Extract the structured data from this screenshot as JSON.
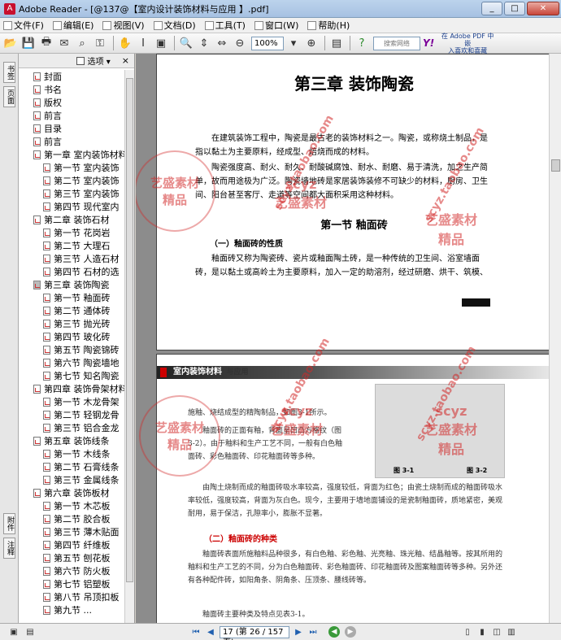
{
  "window": {
    "title": "Adobe Reader - [@137@【室内设计装饰材料与应用 】.pdf]",
    "min": "_",
    "max": "□",
    "close": "✕"
  },
  "menu": [
    {
      "label": "文件(F)"
    },
    {
      "label": "编辑(E)"
    },
    {
      "label": "视图(V)"
    },
    {
      "label": "文档(D)"
    },
    {
      "label": "工具(T)"
    },
    {
      "label": "窗口(W)"
    },
    {
      "label": "帮助(H)"
    }
  ],
  "toolbar": {
    "zoom_value": "100%",
    "search_placeholder": "搜索网络",
    "yahoo": "Y!",
    "promo_line1": "在 Adobe PDF 中嵌",
    "promo_line2": "入喜欢和喜藏"
  },
  "left_tabs": {
    "pages": "书签",
    "thumbs": "页面",
    "attach": "附件",
    "comments": "注释"
  },
  "sidebar": {
    "options_label": "选项 ▾",
    "close": "×",
    "bookmarks": [
      {
        "label": "封面",
        "level": 0
      },
      {
        "label": "书名",
        "level": 0
      },
      {
        "label": "版权",
        "level": 0
      },
      {
        "label": "前言",
        "level": 0
      },
      {
        "label": "目录",
        "level": 0
      },
      {
        "label": "前言",
        "level": 0
      },
      {
        "label": "第一章 室内装饰材料",
        "level": 0
      },
      {
        "label": "第一节 室内装饰",
        "level": 1
      },
      {
        "label": "第二节 室内装饰",
        "level": 1
      },
      {
        "label": "第三节 室内装饰",
        "level": 1
      },
      {
        "label": "第四节 现代室内",
        "level": 1
      },
      {
        "label": "第二章 装饰石材",
        "level": 0
      },
      {
        "label": "第一节 花岗岩",
        "level": 1
      },
      {
        "label": "第二节 大理石",
        "level": 1
      },
      {
        "label": "第三节 人造石材",
        "level": 1
      },
      {
        "label": "第四节 石材的选",
        "level": 1
      },
      {
        "label": "第三章 装饰陶瓷",
        "level": 0,
        "current": true
      },
      {
        "label": "第一节 釉面砖",
        "level": 1
      },
      {
        "label": "第二节 通体砖",
        "level": 1
      },
      {
        "label": "第三节 抛光砖",
        "level": 1
      },
      {
        "label": "第四节 玻化砖",
        "level": 1
      },
      {
        "label": "第五节 陶瓷锦砖",
        "level": 1
      },
      {
        "label": "第六节 陶瓷墙地",
        "level": 1
      },
      {
        "label": "第七节 知名陶瓷",
        "level": 1
      },
      {
        "label": "第四章 装饰骨架材料",
        "level": 0
      },
      {
        "label": "第一节 木龙骨架",
        "level": 1
      },
      {
        "label": "第二节 轻钢龙骨",
        "level": 1
      },
      {
        "label": "第三节 铝合金龙",
        "level": 1
      },
      {
        "label": "第五章 装饰线条",
        "level": 0
      },
      {
        "label": "第一节 木线条",
        "level": 1
      },
      {
        "label": "第二节 石膏线条",
        "level": 1
      },
      {
        "label": "第三节 金属线条",
        "level": 1
      },
      {
        "label": "第六章 装饰板材",
        "level": 0
      },
      {
        "label": "第一节 木芯板",
        "level": 1
      },
      {
        "label": "第二节 胶合板",
        "level": 1
      },
      {
        "label": "第三节 薄木贴面",
        "level": 1
      },
      {
        "label": "第四节 纤维板",
        "level": 1
      },
      {
        "label": "第五节 刨花板",
        "level": 1
      },
      {
        "label": "第六节 防火板",
        "level": 1
      },
      {
        "label": "第七节 铝塑板",
        "level": 1
      },
      {
        "label": "第八节 吊顶扣板",
        "level": 1
      },
      {
        "label": "第九节 ...",
        "level": 1
      }
    ]
  },
  "page1": {
    "chapter_title": "第三章 装饰陶瓷",
    "para1": "在建筑装饰工程中，陶瓷是最古老的装饰材料之一。陶瓷，或称烧土制品，是指以黏土为主要原料，经成型、焙烧而成的材料。",
    "para2": "陶瓷强度高、耐火、耐久、耐酸碱腐蚀、耐水、耐磨、易于清洗，加之生产简单，故而用途极为广泛。陶瓷墙地砖是家居装饰装修不可缺少的材料，厨房、卫生间、阳台甚至客厅、走道等空间都大面积采用这种材料。",
    "section_title": "第一节 釉面砖",
    "subsection": "（一）釉面砖的性质",
    "para3": "釉面砖又称为陶瓷砖、瓷片或釉面陶土砖，是一种传统的卫生间、浴室墙面砖，是以黏土或高岭土为主要原料，加入一定的助溶剂，经过研磨、烘干、筑模、"
  },
  "page2": {
    "header": "室内装饰材料",
    "header_tag": "与应用",
    "line1": "施釉、烧结成型的精陶制品，如图3-1所示。",
    "line2": "釉面砖的正面有釉，背面呈凹凸方格纹（图3-2）。由于釉料和生产工艺不同，一般有白色釉面砖、彩色釉面砖、印花釉面砖等多种。",
    "fig1": "图 3-1",
    "fig2": "图 3-2",
    "para_a": "由陶土烧制而成的釉面砖吸水率较高，强度较低，背面为红色；由瓷土烧制而成的釉面砖吸水率较低，强度较高，背面为灰白色。现今，主要用于墙地面铺设的是瓷制釉面砖，质地紧密，美观耐用，易于保洁，孔隙率小，膨胀不显著。",
    "subsection": "（二）釉面砖的种类",
    "para_b": "釉面砖表面所施釉料品种很多，有白色釉、彩色釉、光亮釉、珠光釉、结晶釉等。按其所用的釉料和生产工艺的不同，分为白色釉面砖、彩色釉面砖、印花釉面砖及图案釉面砖等多种。另外还有各种配件砖，如阳角条、阴角条、压顶条、腰线砖等。",
    "line_last": "釉面砖主要种类及特点见表3-1。"
  },
  "watermark": {
    "top": "scyz.taobao.com",
    "brand": "艺盛素材",
    "sub": "精品",
    "badge": "scyz"
  },
  "status": {
    "page_display": "17 (第 26 / 157 页)"
  }
}
